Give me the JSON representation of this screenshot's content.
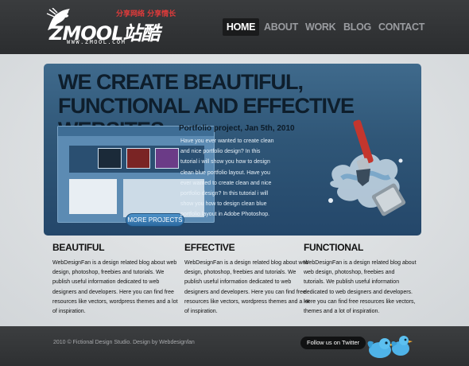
{
  "header": {
    "logo": {
      "tagline": "分享网络 分享情长",
      "brand": "ZMOOL站酷",
      "url": "WWW.ZMOOL.COM"
    },
    "nav": [
      {
        "label": "HOME",
        "active": true
      },
      {
        "label": "ABOUT",
        "active": false
      },
      {
        "label": "WORK",
        "active": false
      },
      {
        "label": "BLOG",
        "active": false
      },
      {
        "label": "CONTACT",
        "active": false
      }
    ]
  },
  "hero": {
    "title": "WE CREATE BEAUTIFUL, FUNCTIONAL AND EFFECTIVE WEBSITES.",
    "project_title": "Portfolio project, Jan 5th, 2010",
    "project_text": "Have you ever wanted to create clean and nice portfolio design? In this tutorial i will show you how to design clean blue portfolio layout. Have you ever wanted to create clean and nice portfolio design? In this tutorial i will show you how to design clean blue portfolio layout in Adobe Photoshop.",
    "more_button": "MORE PROJECTS"
  },
  "columns": [
    {
      "heading": "BEAUTIFUL",
      "text": "WebDesignFan is a design related blog about web design, photoshop, freebies and tutorials. We publish useful information dedicated to web designers and developers. Here you can find free resources like vectors, wordpress themes and a lot of inspiration."
    },
    {
      "heading": "EFFECTIVE",
      "text": "WebDesignFan is a design related blog about web design, photoshop, freebies and tutorials. We publish useful information dedicated to web designers and developers. Here you can find free resources like vectors, wordpress themes and a lot of inspiration."
    },
    {
      "heading": "FUNCTIONAL",
      "text": "WebDesignFan is a design related blog about web design, photoshop, freebies and tutorials. We publish useful information dedicated to web designers and developers. Here you can find free resources like vectors, themes and a lot of inspiration."
    }
  ],
  "footer": {
    "copyright": "2010 © Fictional Design Studio. Design by Webdesignfan",
    "follow_label": "Follow us on Twitter"
  },
  "colors": {
    "header_bg": "#2f3133",
    "hero_bg": "#2f5677",
    "accent_red": "#e03b3b",
    "button_blue": "#2c6aa1"
  },
  "icons": [
    "horse-logo-icon",
    "paint-brush-splash-icon",
    "twitter-birds-icon"
  ]
}
